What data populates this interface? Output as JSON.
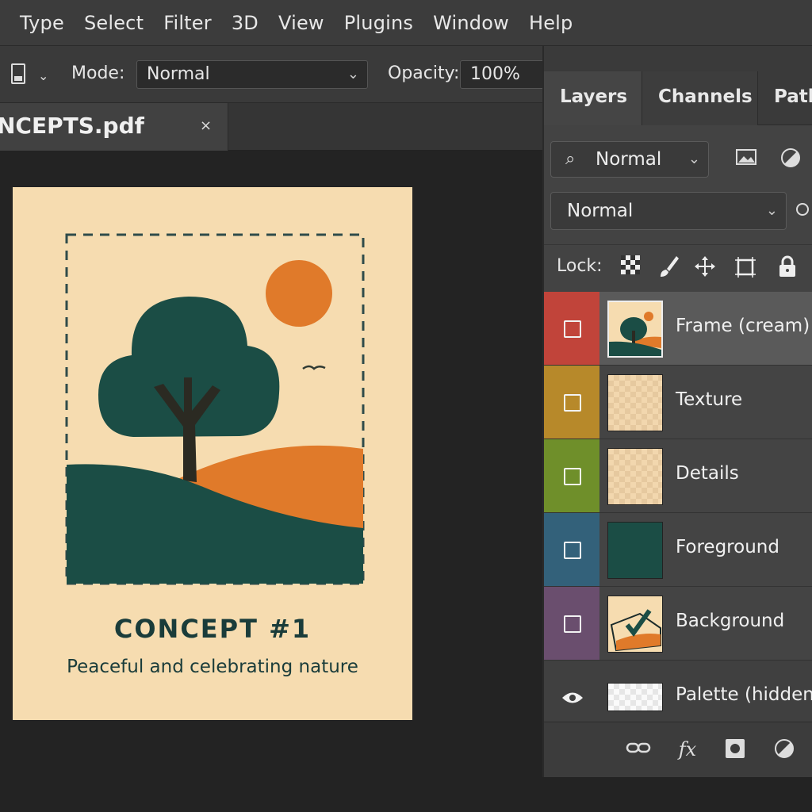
{
  "menu": [
    "Type",
    "Select",
    "Filter",
    "3D",
    "View",
    "Plugins",
    "Window",
    "Help"
  ],
  "options": {
    "mode_label": "Mode:",
    "mode_value": "Normal",
    "opacity_label": "Opacity:",
    "opacity_value": "100%"
  },
  "document": {
    "tab_title": "NCEPTS.pdf",
    "close": "×"
  },
  "artboard": {
    "title": "CONCEPT #1",
    "subtitle": "Peaceful and celebrating nature",
    "colors": {
      "paper": "#f6dcb0",
      "green": "#1b4d45",
      "orange": "#e07a2a",
      "trunk": "#2b2a22"
    }
  },
  "panel": {
    "tabs": [
      "Layers",
      "Channels",
      "Path"
    ],
    "filter_value": "Normal",
    "blend_mode": "Normal",
    "lock_label": "Lock:",
    "layers": [
      {
        "name": "Frame (cream)",
        "color": "#c1443a",
        "selected": true
      },
      {
        "name": "Texture",
        "color": "#b7892a",
        "selected": false
      },
      {
        "name": "Details",
        "color": "#6f8f2a",
        "selected": false
      },
      {
        "name": "Foreground",
        "color": "#33617a",
        "selected": false
      },
      {
        "name": "Background",
        "color": "#6a4e6e",
        "selected": false
      },
      {
        "name": "Palette (hidden)",
        "color": "#444444",
        "selected": false
      }
    ]
  }
}
